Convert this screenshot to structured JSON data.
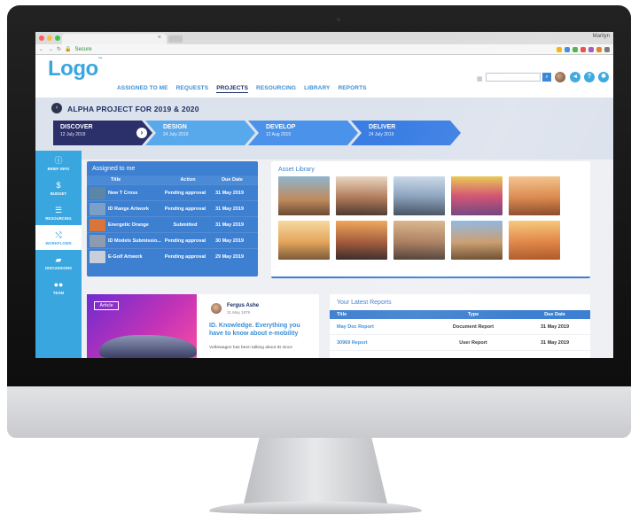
{
  "browser": {
    "tab_close": "×",
    "user": "Marilyn",
    "address_secure": "Secure"
  },
  "header": {
    "logo": "Logo",
    "logo_tm": "™",
    "nav": [
      "ASSIGNED TO ME",
      "REQUESTS",
      "PROJECTS",
      "RESOURCING",
      "LIBRARY",
      "REPORTS"
    ],
    "active_nav": "PROJECTS",
    "icons": [
      "grid-icon",
      "search-icon",
      "avatar",
      "bell-icon",
      "help-icon",
      "settings-icon"
    ],
    "help_label": "?"
  },
  "project": {
    "back_icon": "‹",
    "title": "ALPHA PROJECT FOR 2019 & 2020",
    "phases": [
      {
        "name": "DISCOVER",
        "date": "12 July 2019",
        "color": "#2b2f6a"
      },
      {
        "name": "DESIGN",
        "date": "24 July 2019",
        "color": "#58a8ec"
      },
      {
        "name": "DEVELOP",
        "date": "12 Aug 2019",
        "color": "#4b93ea"
      },
      {
        "name": "DELIVER",
        "date": "24 July 2019",
        "color": "#3a7ee4"
      }
    ],
    "phase_go_icon": "›"
  },
  "sidebar": {
    "items": [
      {
        "label": "BRIEF INFO",
        "icon": "ⓘ"
      },
      {
        "label": "BUDGET",
        "icon": "$"
      },
      {
        "label": "RESOURCING",
        "icon": "☰"
      },
      {
        "label": "WORKFLOWS",
        "icon": "⤭"
      },
      {
        "label": "DISCUSSIONS",
        "icon": "▰"
      },
      {
        "label": "TEAM",
        "icon": "●●"
      }
    ],
    "active": "WORKFLOWS"
  },
  "assigned": {
    "title": "Assigned to me",
    "headers": {
      "title": "Title",
      "action": "Action",
      "due": "Due Date"
    },
    "rows": [
      {
        "title": "New T Cross",
        "action": "Pending approval",
        "due": "31 May 2019",
        "thumb": "#5b86a8"
      },
      {
        "title": "ID Range Artwork",
        "action": "Pending approval",
        "due": "31 May 2019",
        "thumb": "#7aa0c8"
      },
      {
        "title": "Energetic Orange",
        "action": "Submitted",
        "due": "31 May 2019",
        "thumb": "#d9743a"
      },
      {
        "title": "ID Models Submissio...",
        "action": "Pending approval",
        "due": "30 May 2019",
        "thumb": "#8e9ab0"
      },
      {
        "title": "E-Golf Artwork",
        "action": "Pending approval",
        "due": "29 May 2019",
        "thumb": "#c9ced8"
      }
    ]
  },
  "library": {
    "title": "Asset Library",
    "photos": [
      "linear-gradient(180deg,#8fb4cf,#c08a5c 60%,#6a4a34)",
      "linear-gradient(180deg,#e9d6c2,#b07a58 55%,#4d3a30)",
      "linear-gradient(180deg,#c9d8e8,#8aa2bd 50%,#3f4d5e)",
      "linear-gradient(180deg,#e8c64a,#d04a6a 50%,#6a3a7a)",
      "linear-gradient(180deg,#f3c28a,#d9864a 55%,#8a4a2a)",
      "linear-gradient(180deg,#f6d9a0,#e3a45a 55%,#7a5a3a)",
      "linear-gradient(180deg,#f0a85a,#a35a3a 55%,#3a2a2a)",
      "linear-gradient(180deg,#d9b48a,#a87a5a 55%,#4a3a30)",
      "linear-gradient(180deg,#8ab4e0,#c99a6a 55%,#6a4a2a)",
      "linear-gradient(180deg,#f6c87a,#e38a4a 50%,#b05a2a)"
    ]
  },
  "article": {
    "tag": "Article",
    "author": "Fergus Ashe",
    "date": "31 May 1979",
    "headline": "ID. Knowledge. Everything you have to know about e-mobility",
    "excerpt": "Volkswagen has been talking about ID since"
  },
  "reports": {
    "title": "Your Latest Reports",
    "headers": {
      "title": "Title",
      "type": "Type",
      "due": "Due Date"
    },
    "rows": [
      {
        "title": "May Doc Report",
        "type": "Document Report",
        "due": "31 May 2019"
      },
      {
        "title": "30969 Report",
        "type": "User Report",
        "due": "31 May 2019"
      }
    ]
  }
}
